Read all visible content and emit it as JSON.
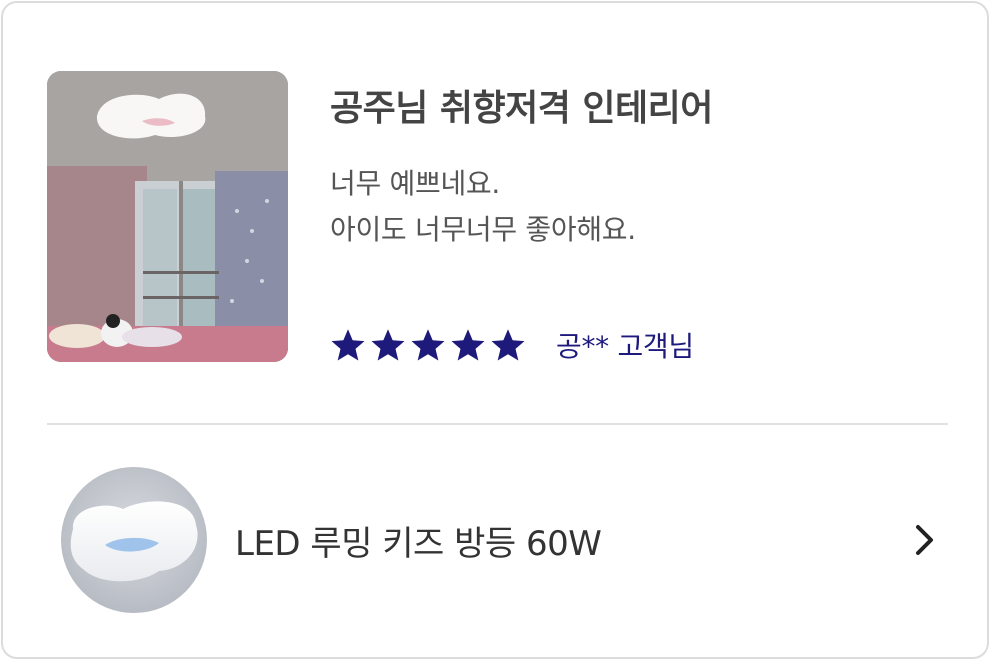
{
  "review": {
    "title": "공주님 취향저격 인테리어",
    "body_lines": [
      "너무 예쁘네요.",
      "아이도 너무너무 좋아해요."
    ],
    "rating": 5,
    "reviewer": "공** 고객님",
    "star_color": "#1e1a7c",
    "photo_icon": "room-photo"
  },
  "product": {
    "name": "LED 루밍 키즈 방등 60W",
    "thumbnail_icon": "ceiling-light-image",
    "chevron_icon": "chevron-right-icon"
  }
}
